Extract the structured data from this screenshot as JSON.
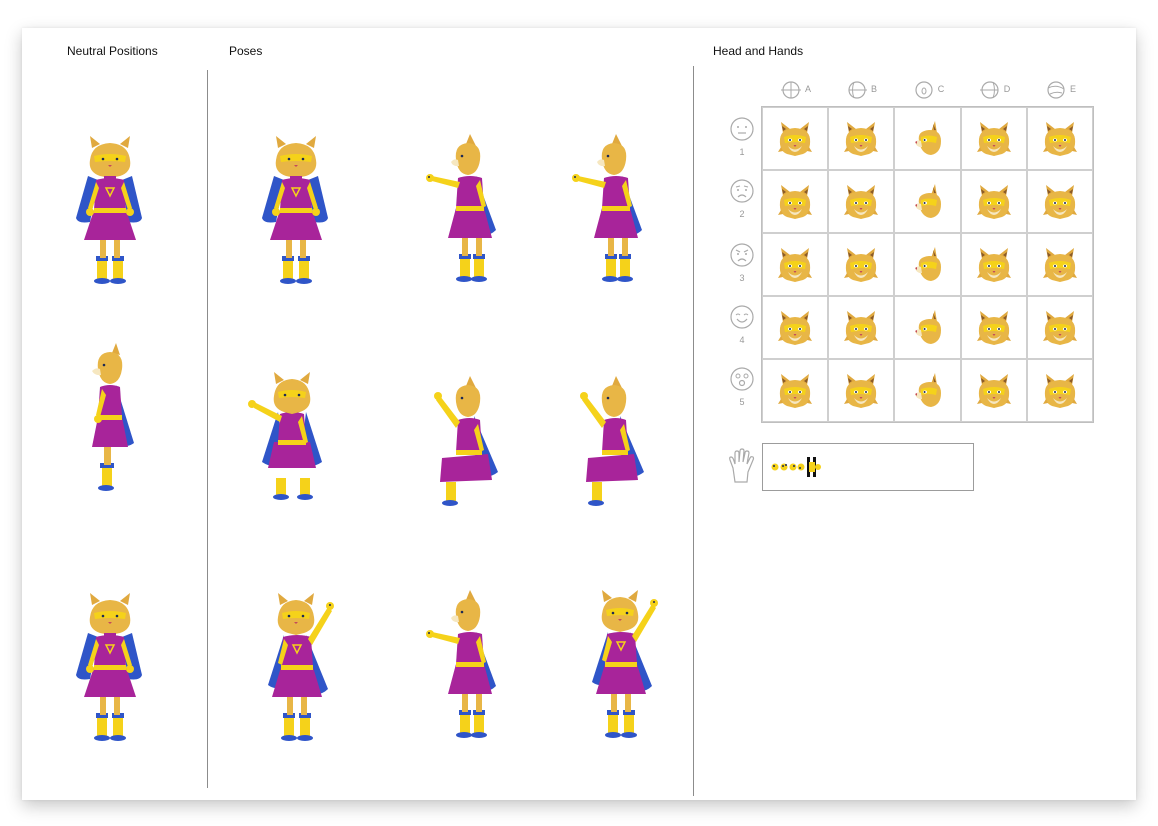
{
  "sections": {
    "neutral": "Neutral Positions",
    "poses": "Poses",
    "head_hands": "Head and Hands"
  },
  "head_columns": [
    "A",
    "B",
    "C",
    "D",
    "E"
  ],
  "expression_rows": [
    "1",
    "2",
    "3",
    "4",
    "5"
  ],
  "icons": {
    "column": [
      "head-front-icon",
      "head-three-quarter-icon",
      "head-side-icon",
      "head-three-quarter-back-icon",
      "head-back-icon"
    ],
    "rows": [
      "neutral-face-icon",
      "worried-face-icon",
      "angry-face-icon",
      "happy-face-icon",
      "surprised-face-icon"
    ],
    "hand": "hand-icon"
  },
  "colors": {
    "fur": "#e8b646",
    "dress": "#a8249a",
    "cape": "#2f55c8",
    "boots": "#f5d21a",
    "divider": "#8c8c8c"
  }
}
